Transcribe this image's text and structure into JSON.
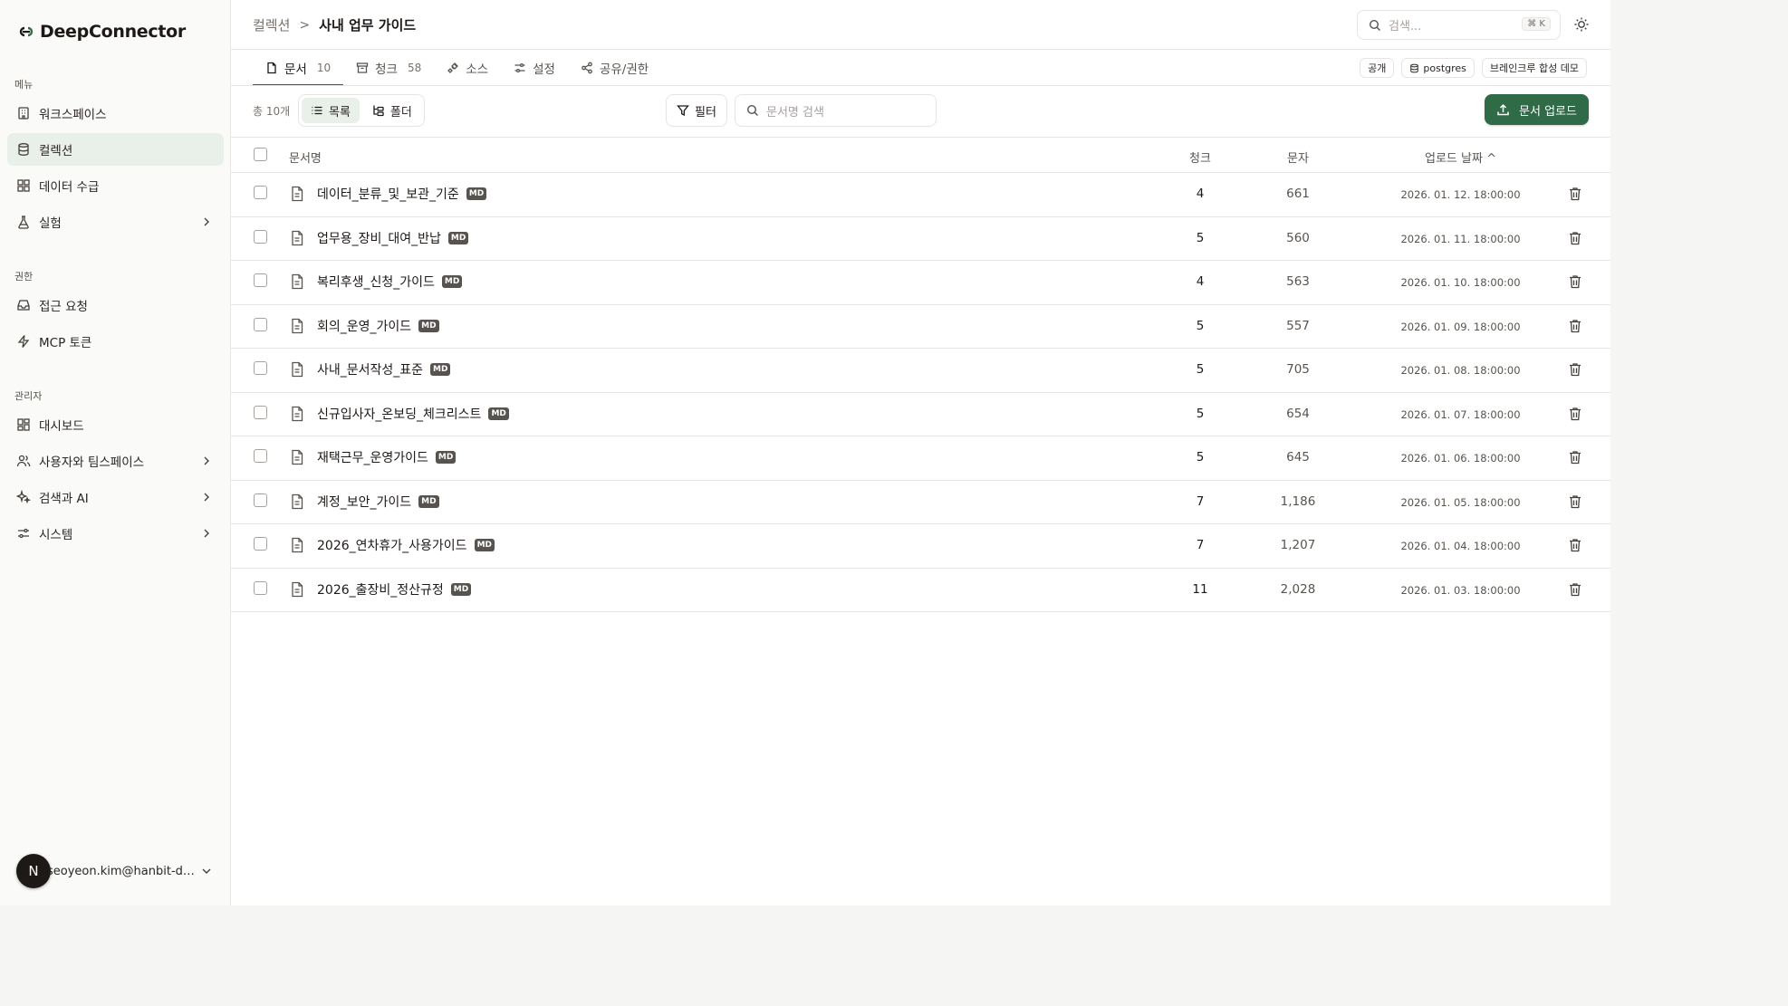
{
  "brand": {
    "name": "DeepConnector"
  },
  "sidebar": {
    "sections": [
      {
        "label": "메뉴"
      },
      {
        "label": "권한"
      },
      {
        "label": "관리자"
      }
    ],
    "items": [
      {
        "label": "워크스페이스",
        "icon": "building-icon"
      },
      {
        "label": "컬렉션",
        "icon": "database-icon",
        "active": true
      },
      {
        "label": "데이터 수급",
        "icon": "grid-icon"
      },
      {
        "label": "실험",
        "icon": "flask-icon",
        "expandable": true
      },
      {
        "label": "접근 요청",
        "icon": "inbox-icon"
      },
      {
        "label": "MCP 토큰",
        "icon": "bolt-icon"
      },
      {
        "label": "대시보드",
        "icon": "dashboard-icon"
      },
      {
        "label": "사용자와 팀스페이스",
        "icon": "users-icon",
        "expandable": true
      },
      {
        "label": "검색과 AI",
        "icon": "sparkle-icon",
        "expandable": true
      },
      {
        "label": "시스템",
        "icon": "sliders-icon",
        "expandable": true
      }
    ],
    "user": {
      "avatar_letter": "N",
      "email": "seoyeon.kim@hanbit-de..."
    }
  },
  "header": {
    "breadcrumb_parent": "컬렉션",
    "breadcrumb_sep": ">",
    "breadcrumb_current": "사내 업무 가이드",
    "search_placeholder": "검색...",
    "search_shortcut": "⌘ K"
  },
  "tabs": [
    {
      "label": "문서",
      "count": "10",
      "active": true
    },
    {
      "label": "청크",
      "count": "58"
    },
    {
      "label": "소스",
      "count": ""
    },
    {
      "label": "설정",
      "count": ""
    },
    {
      "label": "공유/권한",
      "count": ""
    }
  ],
  "chips": {
    "visibility": "공개",
    "db": "postgres",
    "dataset": "브레인크루 합성 데모"
  },
  "toolbar": {
    "total": "총 10개",
    "view_list": "목록",
    "view_folder": "폴더",
    "filter": "필터",
    "doc_search_placeholder": "문서명 검색",
    "upload": "문서 업로드"
  },
  "table": {
    "columns": {
      "name": "문서명",
      "chunks": "청크",
      "chars": "문자",
      "date": "업로드 날짜 ^"
    },
    "badge": "MD",
    "rows": [
      {
        "name": "데이터_분류_및_보관_기준",
        "chunks": "4",
        "chars": "661",
        "date": "2026. 01. 12. 18:00:00"
      },
      {
        "name": "업무용_장비_대여_반납",
        "chunks": "5",
        "chars": "560",
        "date": "2026. 01. 11. 18:00:00"
      },
      {
        "name": "복리후생_신청_가이드",
        "chunks": "4",
        "chars": "563",
        "date": "2026. 01. 10. 18:00:00"
      },
      {
        "name": "회의_운영_가이드",
        "chunks": "5",
        "chars": "557",
        "date": "2026. 01. 09. 18:00:00"
      },
      {
        "name": "사내_문서작성_표준",
        "chunks": "5",
        "chars": "705",
        "date": "2026. 01. 08. 18:00:00"
      },
      {
        "name": "신규입사자_온보딩_체크리스트",
        "chunks": "5",
        "chars": "654",
        "date": "2026. 01. 07. 18:00:00"
      },
      {
        "name": "재택근무_운영가이드",
        "chunks": "5",
        "chars": "645",
        "date": "2026. 01. 06. 18:00:00"
      },
      {
        "name": "계정_보안_가이드",
        "chunks": "7",
        "chars": "1,186",
        "date": "2026. 01. 05. 18:00:00"
      },
      {
        "name": "2026_연차휴가_사용가이드",
        "chunks": "7",
        "chars": "1,207",
        "date": "2026. 01. 04. 18:00:00"
      },
      {
        "name": "2026_출장비_정산규정",
        "chunks": "11",
        "chars": "2,028",
        "date": "2026. 01. 03. 18:00:00"
      }
    ]
  },
  "colors": {
    "accent": "#2f6b47",
    "active_bg": "#e9efe9",
    "border": "#e7e5e4"
  }
}
